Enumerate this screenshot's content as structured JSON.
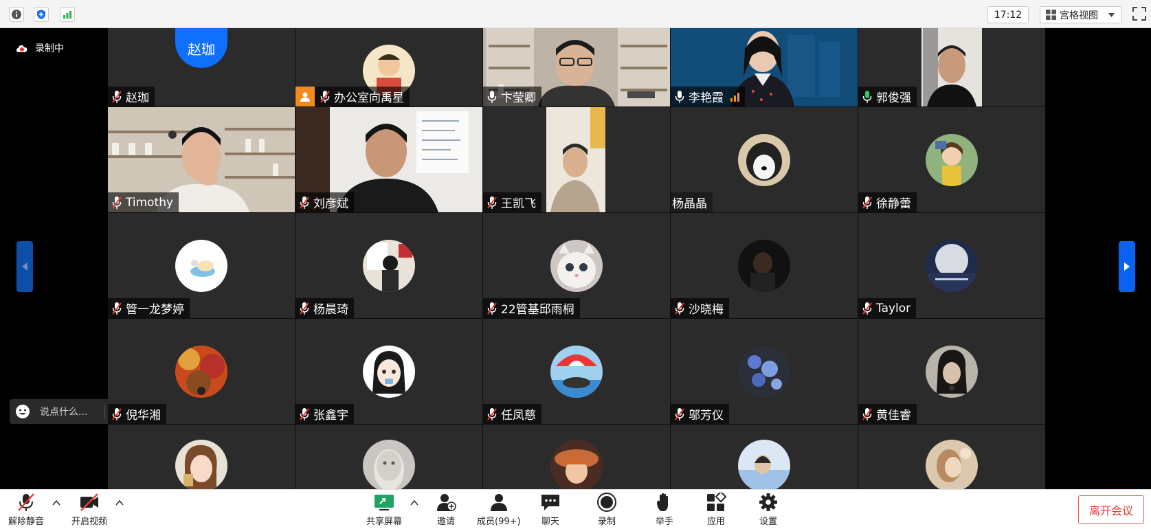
{
  "topbar": {
    "time": "17:12",
    "view_label": "宫格视图"
  },
  "sidebar": {
    "recording_label": "录制中",
    "chat_placeholder": "说点什么..."
  },
  "participants": [
    {
      "name": "赵珈",
      "avatar_text": "赵珈",
      "mic": "muted",
      "kind": "text-avatar"
    },
    {
      "name": "办公室向禹星",
      "mic": "muted",
      "kind": "avatar",
      "host": true
    },
    {
      "name": "卞莹卿",
      "mic": "on",
      "kind": "video"
    },
    {
      "name": "李艳霞",
      "mic": "on",
      "kind": "video",
      "signal": true
    },
    {
      "name": "郭俊强",
      "mic": "speaking",
      "kind": "video",
      "active": true
    },
    {
      "name": "Timothy",
      "mic": "muted",
      "kind": "video"
    },
    {
      "name": "刘彦斌",
      "mic": "muted",
      "kind": "video"
    },
    {
      "name": "王凯飞",
      "mic": "muted",
      "kind": "video"
    },
    {
      "name": "杨晶晶",
      "mic": "none",
      "kind": "avatar"
    },
    {
      "name": "徐静蕾",
      "mic": "muted",
      "kind": "avatar"
    },
    {
      "name": "管一龙梦婷",
      "mic": "muted",
      "kind": "avatar"
    },
    {
      "name": "杨晨琦",
      "mic": "muted",
      "kind": "avatar"
    },
    {
      "name": "22管基邱雨桐",
      "mic": "muted",
      "kind": "avatar"
    },
    {
      "name": "沙晓梅",
      "mic": "muted",
      "kind": "avatar"
    },
    {
      "name": "Taylor",
      "mic": "muted",
      "kind": "avatar"
    },
    {
      "name": "倪华湘",
      "mic": "muted",
      "kind": "avatar"
    },
    {
      "name": "张鑫宇",
      "mic": "muted",
      "kind": "avatar"
    },
    {
      "name": "任凤慈",
      "mic": "muted",
      "kind": "avatar"
    },
    {
      "name": "邬芳仪",
      "mic": "muted",
      "kind": "avatar"
    },
    {
      "name": "黄佳睿",
      "mic": "muted",
      "kind": "avatar"
    },
    {
      "name": "",
      "mic": "none",
      "kind": "avatar"
    },
    {
      "name": "",
      "mic": "none",
      "kind": "avatar"
    },
    {
      "name": "",
      "mic": "none",
      "kind": "avatar"
    },
    {
      "name": "",
      "mic": "none",
      "kind": "avatar"
    },
    {
      "name": "",
      "mic": "none",
      "kind": "avatar"
    }
  ],
  "toolbar": {
    "unmute": "解除静音",
    "start_video": "开启视频",
    "share_screen": "共享屏幕",
    "invite": "邀请",
    "members": "成员(99+)",
    "chat": "聊天",
    "record": "录制",
    "raise_hand": "举手",
    "apps": "应用",
    "settings": "设置",
    "leave": "离开会议"
  },
  "colors": {
    "accent": "#0a63f0",
    "leave": "#e53935",
    "speaking": "#24d06b",
    "host_badge": "#f08a1c"
  }
}
